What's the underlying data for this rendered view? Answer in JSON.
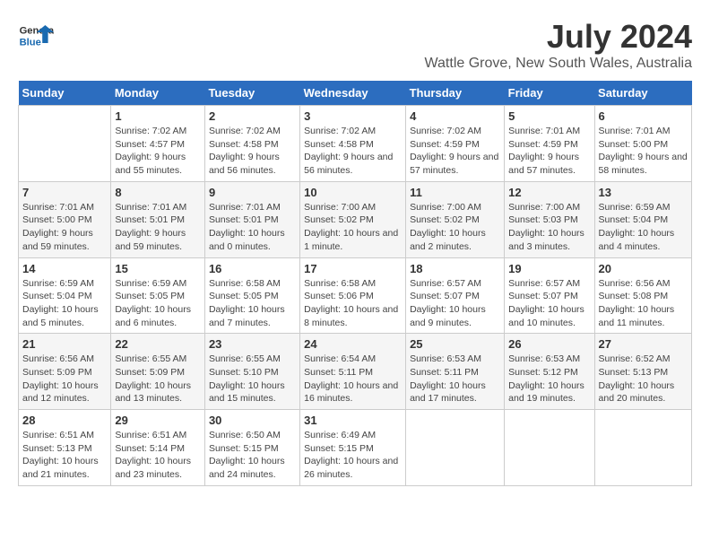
{
  "logo": {
    "line1": "General",
    "line2": "Blue"
  },
  "title": "July 2024",
  "subtitle": "Wattle Grove, New South Wales, Australia",
  "days_of_week": [
    "Sunday",
    "Monday",
    "Tuesday",
    "Wednesday",
    "Thursday",
    "Friday",
    "Saturday"
  ],
  "weeks": [
    [
      {
        "day": "",
        "sunrise": "",
        "sunset": "",
        "daylight": ""
      },
      {
        "day": "1",
        "sunrise": "Sunrise: 7:02 AM",
        "sunset": "Sunset: 4:57 PM",
        "daylight": "Daylight: 9 hours and 55 minutes."
      },
      {
        "day": "2",
        "sunrise": "Sunrise: 7:02 AM",
        "sunset": "Sunset: 4:58 PM",
        "daylight": "Daylight: 9 hours and 56 minutes."
      },
      {
        "day": "3",
        "sunrise": "Sunrise: 7:02 AM",
        "sunset": "Sunset: 4:58 PM",
        "daylight": "Daylight: 9 hours and 56 minutes."
      },
      {
        "day": "4",
        "sunrise": "Sunrise: 7:02 AM",
        "sunset": "Sunset: 4:59 PM",
        "daylight": "Daylight: 9 hours and 57 minutes."
      },
      {
        "day": "5",
        "sunrise": "Sunrise: 7:01 AM",
        "sunset": "Sunset: 4:59 PM",
        "daylight": "Daylight: 9 hours and 57 minutes."
      },
      {
        "day": "6",
        "sunrise": "Sunrise: 7:01 AM",
        "sunset": "Sunset: 5:00 PM",
        "daylight": "Daylight: 9 hours and 58 minutes."
      }
    ],
    [
      {
        "day": "7",
        "sunrise": "Sunrise: 7:01 AM",
        "sunset": "Sunset: 5:00 PM",
        "daylight": "Daylight: 9 hours and 59 minutes."
      },
      {
        "day": "8",
        "sunrise": "Sunrise: 7:01 AM",
        "sunset": "Sunset: 5:01 PM",
        "daylight": "Daylight: 9 hours and 59 minutes."
      },
      {
        "day": "9",
        "sunrise": "Sunrise: 7:01 AM",
        "sunset": "Sunset: 5:01 PM",
        "daylight": "Daylight: 10 hours and 0 minutes."
      },
      {
        "day": "10",
        "sunrise": "Sunrise: 7:00 AM",
        "sunset": "Sunset: 5:02 PM",
        "daylight": "Daylight: 10 hours and 1 minute."
      },
      {
        "day": "11",
        "sunrise": "Sunrise: 7:00 AM",
        "sunset": "Sunset: 5:02 PM",
        "daylight": "Daylight: 10 hours and 2 minutes."
      },
      {
        "day": "12",
        "sunrise": "Sunrise: 7:00 AM",
        "sunset": "Sunset: 5:03 PM",
        "daylight": "Daylight: 10 hours and 3 minutes."
      },
      {
        "day": "13",
        "sunrise": "Sunrise: 6:59 AM",
        "sunset": "Sunset: 5:04 PM",
        "daylight": "Daylight: 10 hours and 4 minutes."
      }
    ],
    [
      {
        "day": "14",
        "sunrise": "Sunrise: 6:59 AM",
        "sunset": "Sunset: 5:04 PM",
        "daylight": "Daylight: 10 hours and 5 minutes."
      },
      {
        "day": "15",
        "sunrise": "Sunrise: 6:59 AM",
        "sunset": "Sunset: 5:05 PM",
        "daylight": "Daylight: 10 hours and 6 minutes."
      },
      {
        "day": "16",
        "sunrise": "Sunrise: 6:58 AM",
        "sunset": "Sunset: 5:05 PM",
        "daylight": "Daylight: 10 hours and 7 minutes."
      },
      {
        "day": "17",
        "sunrise": "Sunrise: 6:58 AM",
        "sunset": "Sunset: 5:06 PM",
        "daylight": "Daylight: 10 hours and 8 minutes."
      },
      {
        "day": "18",
        "sunrise": "Sunrise: 6:57 AM",
        "sunset": "Sunset: 5:07 PM",
        "daylight": "Daylight: 10 hours and 9 minutes."
      },
      {
        "day": "19",
        "sunrise": "Sunrise: 6:57 AM",
        "sunset": "Sunset: 5:07 PM",
        "daylight": "Daylight: 10 hours and 10 minutes."
      },
      {
        "day": "20",
        "sunrise": "Sunrise: 6:56 AM",
        "sunset": "Sunset: 5:08 PM",
        "daylight": "Daylight: 10 hours and 11 minutes."
      }
    ],
    [
      {
        "day": "21",
        "sunrise": "Sunrise: 6:56 AM",
        "sunset": "Sunset: 5:09 PM",
        "daylight": "Daylight: 10 hours and 12 minutes."
      },
      {
        "day": "22",
        "sunrise": "Sunrise: 6:55 AM",
        "sunset": "Sunset: 5:09 PM",
        "daylight": "Daylight: 10 hours and 13 minutes."
      },
      {
        "day": "23",
        "sunrise": "Sunrise: 6:55 AM",
        "sunset": "Sunset: 5:10 PM",
        "daylight": "Daylight: 10 hours and 15 minutes."
      },
      {
        "day": "24",
        "sunrise": "Sunrise: 6:54 AM",
        "sunset": "Sunset: 5:11 PM",
        "daylight": "Daylight: 10 hours and 16 minutes."
      },
      {
        "day": "25",
        "sunrise": "Sunrise: 6:53 AM",
        "sunset": "Sunset: 5:11 PM",
        "daylight": "Daylight: 10 hours and 17 minutes."
      },
      {
        "day": "26",
        "sunrise": "Sunrise: 6:53 AM",
        "sunset": "Sunset: 5:12 PM",
        "daylight": "Daylight: 10 hours and 19 minutes."
      },
      {
        "day": "27",
        "sunrise": "Sunrise: 6:52 AM",
        "sunset": "Sunset: 5:13 PM",
        "daylight": "Daylight: 10 hours and 20 minutes."
      }
    ],
    [
      {
        "day": "28",
        "sunrise": "Sunrise: 6:51 AM",
        "sunset": "Sunset: 5:13 PM",
        "daylight": "Daylight: 10 hours and 21 minutes."
      },
      {
        "day": "29",
        "sunrise": "Sunrise: 6:51 AM",
        "sunset": "Sunset: 5:14 PM",
        "daylight": "Daylight: 10 hours and 23 minutes."
      },
      {
        "day": "30",
        "sunrise": "Sunrise: 6:50 AM",
        "sunset": "Sunset: 5:15 PM",
        "daylight": "Daylight: 10 hours and 24 minutes."
      },
      {
        "day": "31",
        "sunrise": "Sunrise: 6:49 AM",
        "sunset": "Sunset: 5:15 PM",
        "daylight": "Daylight: 10 hours and 26 minutes."
      },
      {
        "day": "",
        "sunrise": "",
        "sunset": "",
        "daylight": ""
      },
      {
        "day": "",
        "sunrise": "",
        "sunset": "",
        "daylight": ""
      },
      {
        "day": "",
        "sunrise": "",
        "sunset": "",
        "daylight": ""
      }
    ]
  ]
}
